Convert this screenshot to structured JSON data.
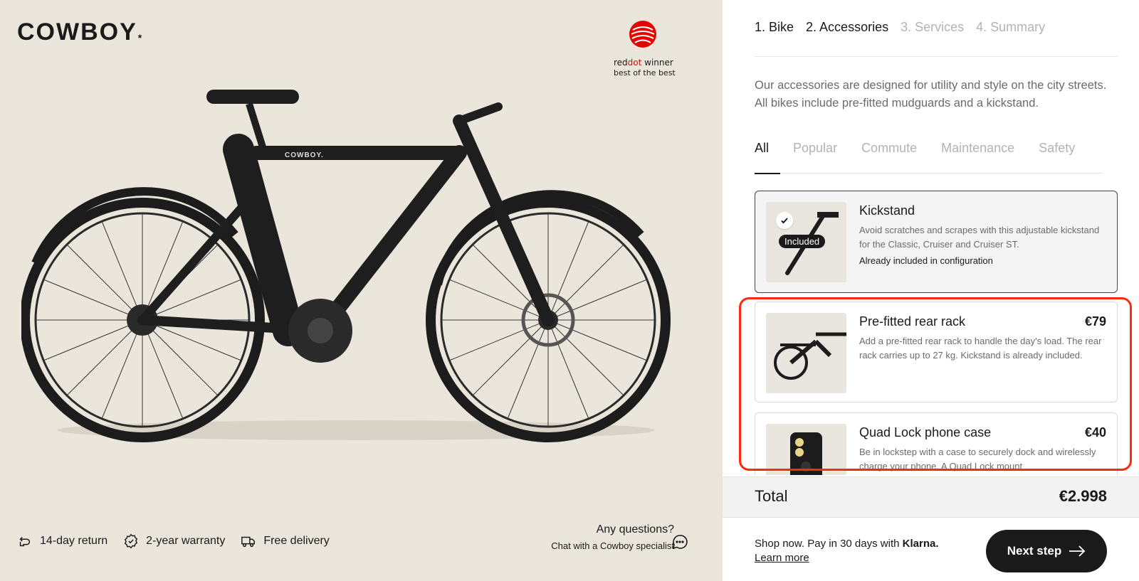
{
  "brand": {
    "logo_text": "COWBOY",
    "logo_mark": "*"
  },
  "award": {
    "line1_prefix": "red",
    "line1_red": "dot",
    "line1_suffix": " winner",
    "line2": "best of the best"
  },
  "perks": [
    {
      "label": "14-day return",
      "icon": "return-icon"
    },
    {
      "label": "2-year warranty",
      "icon": "warranty-badge-icon"
    },
    {
      "label": "Free delivery",
      "icon": "delivery-truck-icon"
    }
  ],
  "questions": {
    "title": "Any questions?",
    "subtitle": "Chat with a Cowboy specialist"
  },
  "steps": [
    {
      "label": "1. Bike",
      "active": true
    },
    {
      "label": "2. Accessories",
      "active": true
    },
    {
      "label": "3. Services",
      "active": false
    },
    {
      "label": "4. Summary",
      "active": false
    }
  ],
  "intro": "Our accessories are designed for utility and style on the city streets. All bikes include pre-fitted mudguards and a kickstand.",
  "filters": [
    {
      "label": "All",
      "active": true
    },
    {
      "label": "Popular",
      "active": false
    },
    {
      "label": "Commute",
      "active": false
    },
    {
      "label": "Maintenance",
      "active": false
    },
    {
      "label": "Safety",
      "active": false
    }
  ],
  "accessories": [
    {
      "title": "Kickstand",
      "price": "",
      "description": "Avoid scratches and scrapes with this adjustable kickstand for the Classic, Cruiser and Cruiser ST.",
      "note": "Already included in configuration",
      "badge": "Included"
    },
    {
      "title": "Pre-fitted rear rack",
      "price": "€79",
      "description": "Add a pre-fitted rear rack to handle the day's load. The rear rack carries up to 27 kg. Kickstand is already included."
    },
    {
      "title": "Quad Lock phone case",
      "price": "€40",
      "description": "Be in lockstep with a case to securely dock and wirelessly charge your phone. A Quad Lock mount"
    }
  ],
  "total": {
    "label": "Total",
    "amount": "€2.998"
  },
  "klarna": {
    "text": "Shop now. Pay in 30 days with ",
    "brand": "Klarna.",
    "learn_more": "Learn more"
  },
  "next_button": {
    "label": "Next step"
  },
  "colors": {
    "hero_bg": "#ebe6dc",
    "accent_red": "#e10600",
    "highlight": "#ff2a0e",
    "dark": "#1a1a1a"
  }
}
